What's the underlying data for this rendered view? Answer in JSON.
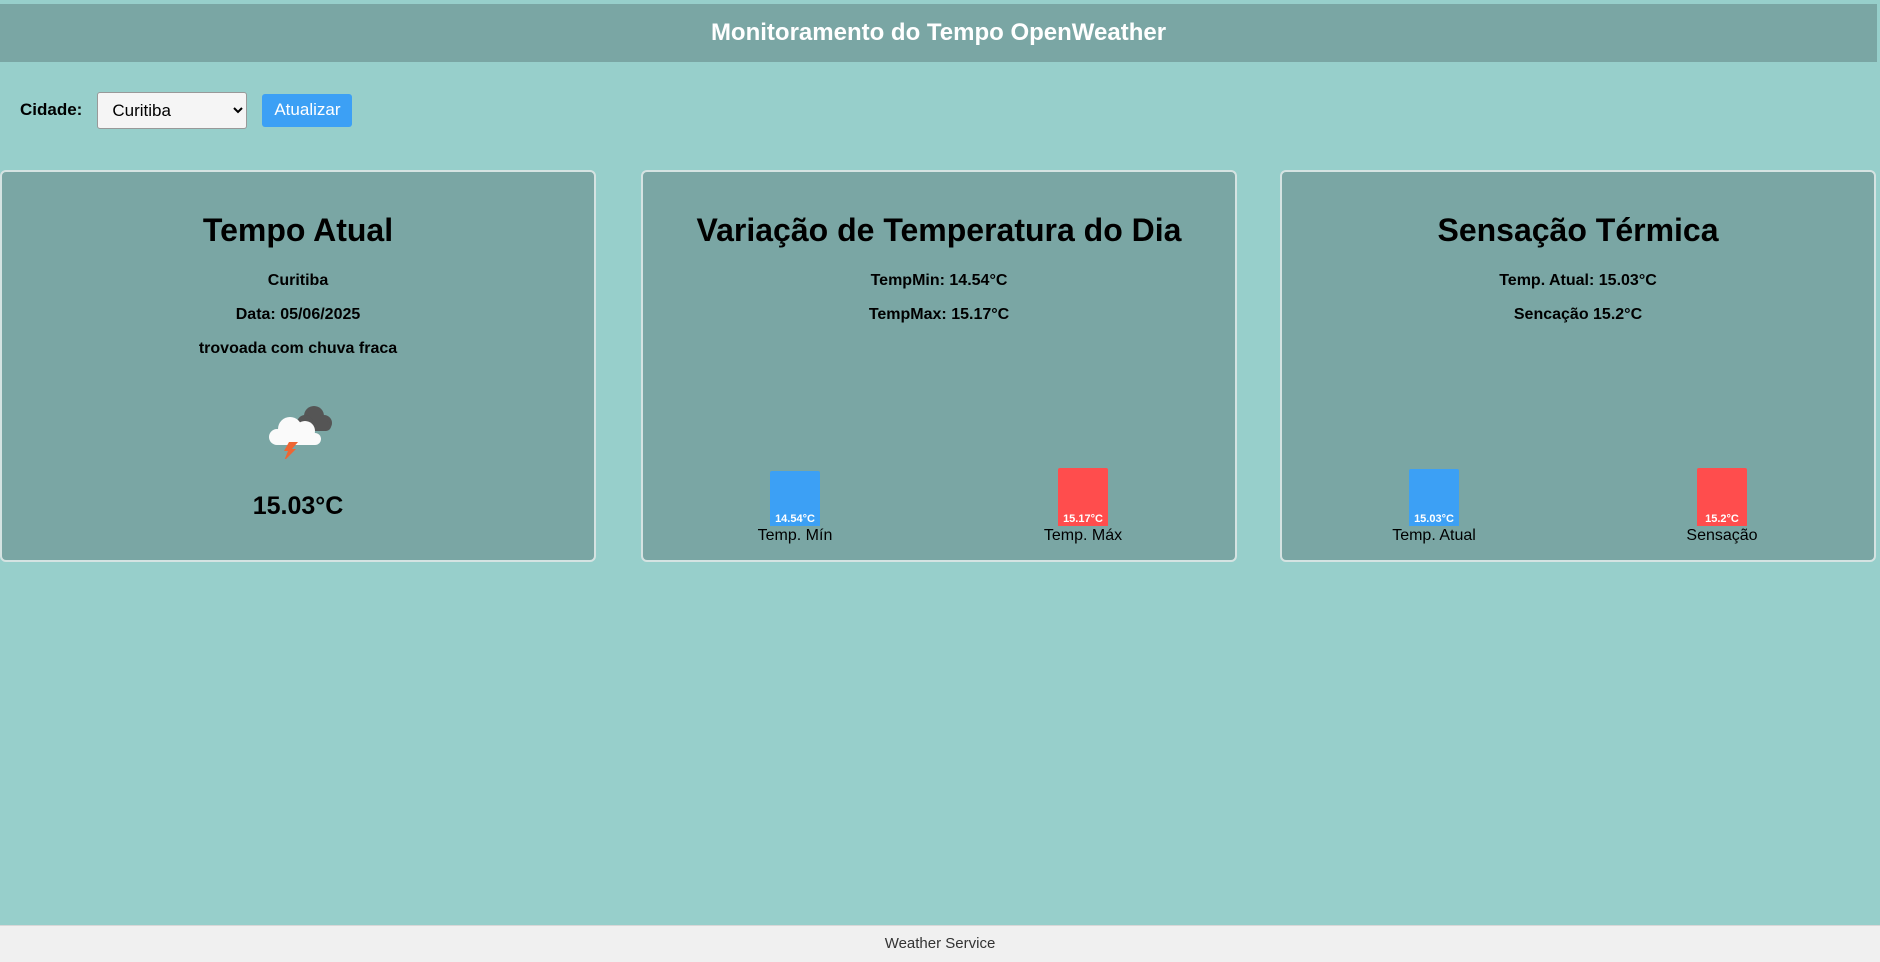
{
  "header": {
    "title": "Monitoramento do Tempo OpenWeather"
  },
  "controls": {
    "city_label": "Cidade:",
    "city_value": "Curitiba",
    "update_label": "Atualizar"
  },
  "current": {
    "title": "Tempo Atual",
    "city": "Curitiba",
    "date": "Data: 05/06/2025",
    "description": "trovoada com chuva fraca",
    "icon": "thunderstorm-rain-cloud-icon",
    "temp": "15.03°C"
  },
  "variation": {
    "title": "Variação de Temperatura do Dia",
    "min_text": "TempMin: 14.54°C",
    "max_text": "TempMax: 15.17°C",
    "bars": [
      {
        "label": "Temp. Mín",
        "value": 14.54,
        "value_label": "14.54°C",
        "color": "#3ca0f5"
      },
      {
        "label": "Temp. Máx",
        "value": 15.17,
        "value_label": "15.17°C",
        "color": "#ff4d4d"
      }
    ]
  },
  "feels": {
    "title": "Sensação Térmica",
    "current_text": "Temp. Atual: 15.03°C",
    "feels_text": "Sencação 15.2°C",
    "bars": [
      {
        "label": "Temp. Atual",
        "value": 15.03,
        "value_label": "15.03°C",
        "color": "#3ca0f5"
      },
      {
        "label": "Sensação",
        "value": 15.2,
        "value_label": "15.2°C",
        "color": "#ff4d4d"
      }
    ]
  },
  "footer": {
    "text": "Weather Service"
  },
  "colors": {
    "page_bg": "#97cfcb",
    "panel_bg": "#7aa6a4",
    "blue": "#3ca0f5",
    "red": "#ff4d4d"
  }
}
